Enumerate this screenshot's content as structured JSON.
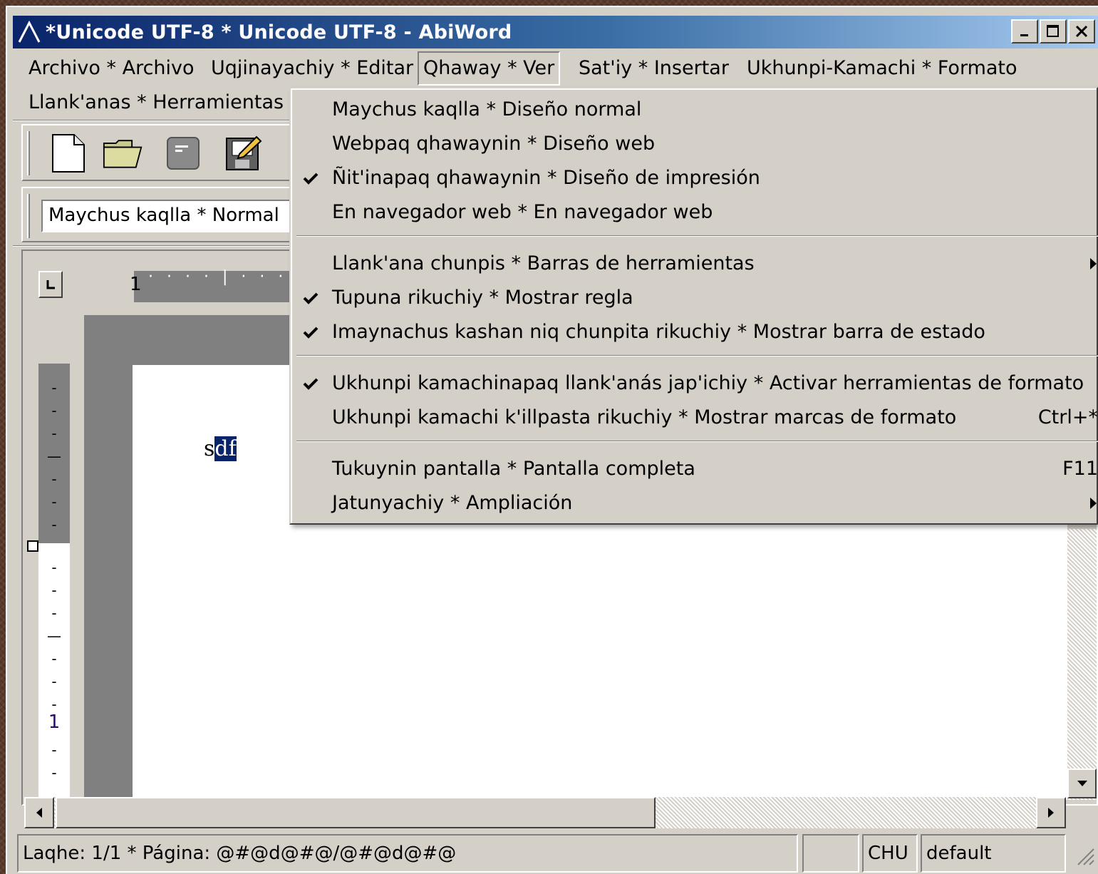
{
  "window": {
    "title": "*Unicode UTF-8 * Unicode UTF-8 - AbiWord"
  },
  "menubar": {
    "items": [
      {
        "label": "Archivo * Archivo"
      },
      {
        "label": "Uqjinayachiy * Editar"
      },
      {
        "label": "Qhaway * Ver"
      },
      {
        "label": "Sat'iy * Insertar"
      },
      {
        "label": "Ukhunpi-Kamachi * Formato"
      },
      {
        "label": "Llank'anas * Herramientas"
      }
    ]
  },
  "toolbar": {
    "icons": [
      "new-document-icon",
      "open-folder-icon",
      "document-icon",
      "save-icon"
    ]
  },
  "style_combo": {
    "value": "Maychus kaqlla * Normal"
  },
  "ruler": {
    "horizontal_number": "1",
    "vertical_number": "1"
  },
  "document": {
    "text_before": "s",
    "text_selected": "df"
  },
  "view_menu": {
    "items": [
      {
        "label": "Maychus kaqlla * Diseño normal",
        "checked": false,
        "accel": "",
        "submenu": false
      },
      {
        "label": "Webpaq qhawaynin * Diseño web",
        "checked": false,
        "accel": "",
        "submenu": false
      },
      {
        "label": "Ñit'inapaq qhawaynin * Diseño de impresión",
        "checked": true,
        "accel": "",
        "submenu": false
      },
      {
        "label": "En navegador web * En navegador web",
        "checked": false,
        "accel": "",
        "submenu": false
      },
      {
        "label": "Llank'ana chunpis * Barras de herramientas",
        "checked": false,
        "accel": "",
        "submenu": true
      },
      {
        "label": "Tupuna rikuchiy * Mostrar regla",
        "checked": true,
        "accel": "",
        "submenu": false
      },
      {
        "label": "Imaynachus kashan niq chunpita rikuchiy * Mostrar barra de estado",
        "checked": true,
        "accel": "",
        "submenu": false
      },
      {
        "label": "Ukhunpi kamachinapaq llank'anás jap'ichiy * Activar herramientas de formato",
        "checked": true,
        "accel": "",
        "submenu": false
      },
      {
        "label": "Ukhunpi kamachi k'illpasta rikuchiy * Mostrar marcas de formato",
        "checked": false,
        "accel": "Ctrl+*",
        "submenu": false
      },
      {
        "label": "Tukuynin pantalla * Pantalla completa",
        "checked": false,
        "accel": "F11",
        "submenu": false
      },
      {
        "label": "Jatunyachiy * Ampliación",
        "checked": false,
        "accel": "",
        "submenu": true
      }
    ]
  },
  "statusbar": {
    "page": "Laqhe: 1/1 * Página: @#@d@#@/@#@d@#@",
    "empty": "",
    "lang": "CHU",
    "mode": "default"
  },
  "colors": {
    "title_gradient_start": "#0a246a",
    "title_gradient_end": "#a6caf0",
    "face": "#d4d0c8",
    "selection": "#0a246a"
  }
}
